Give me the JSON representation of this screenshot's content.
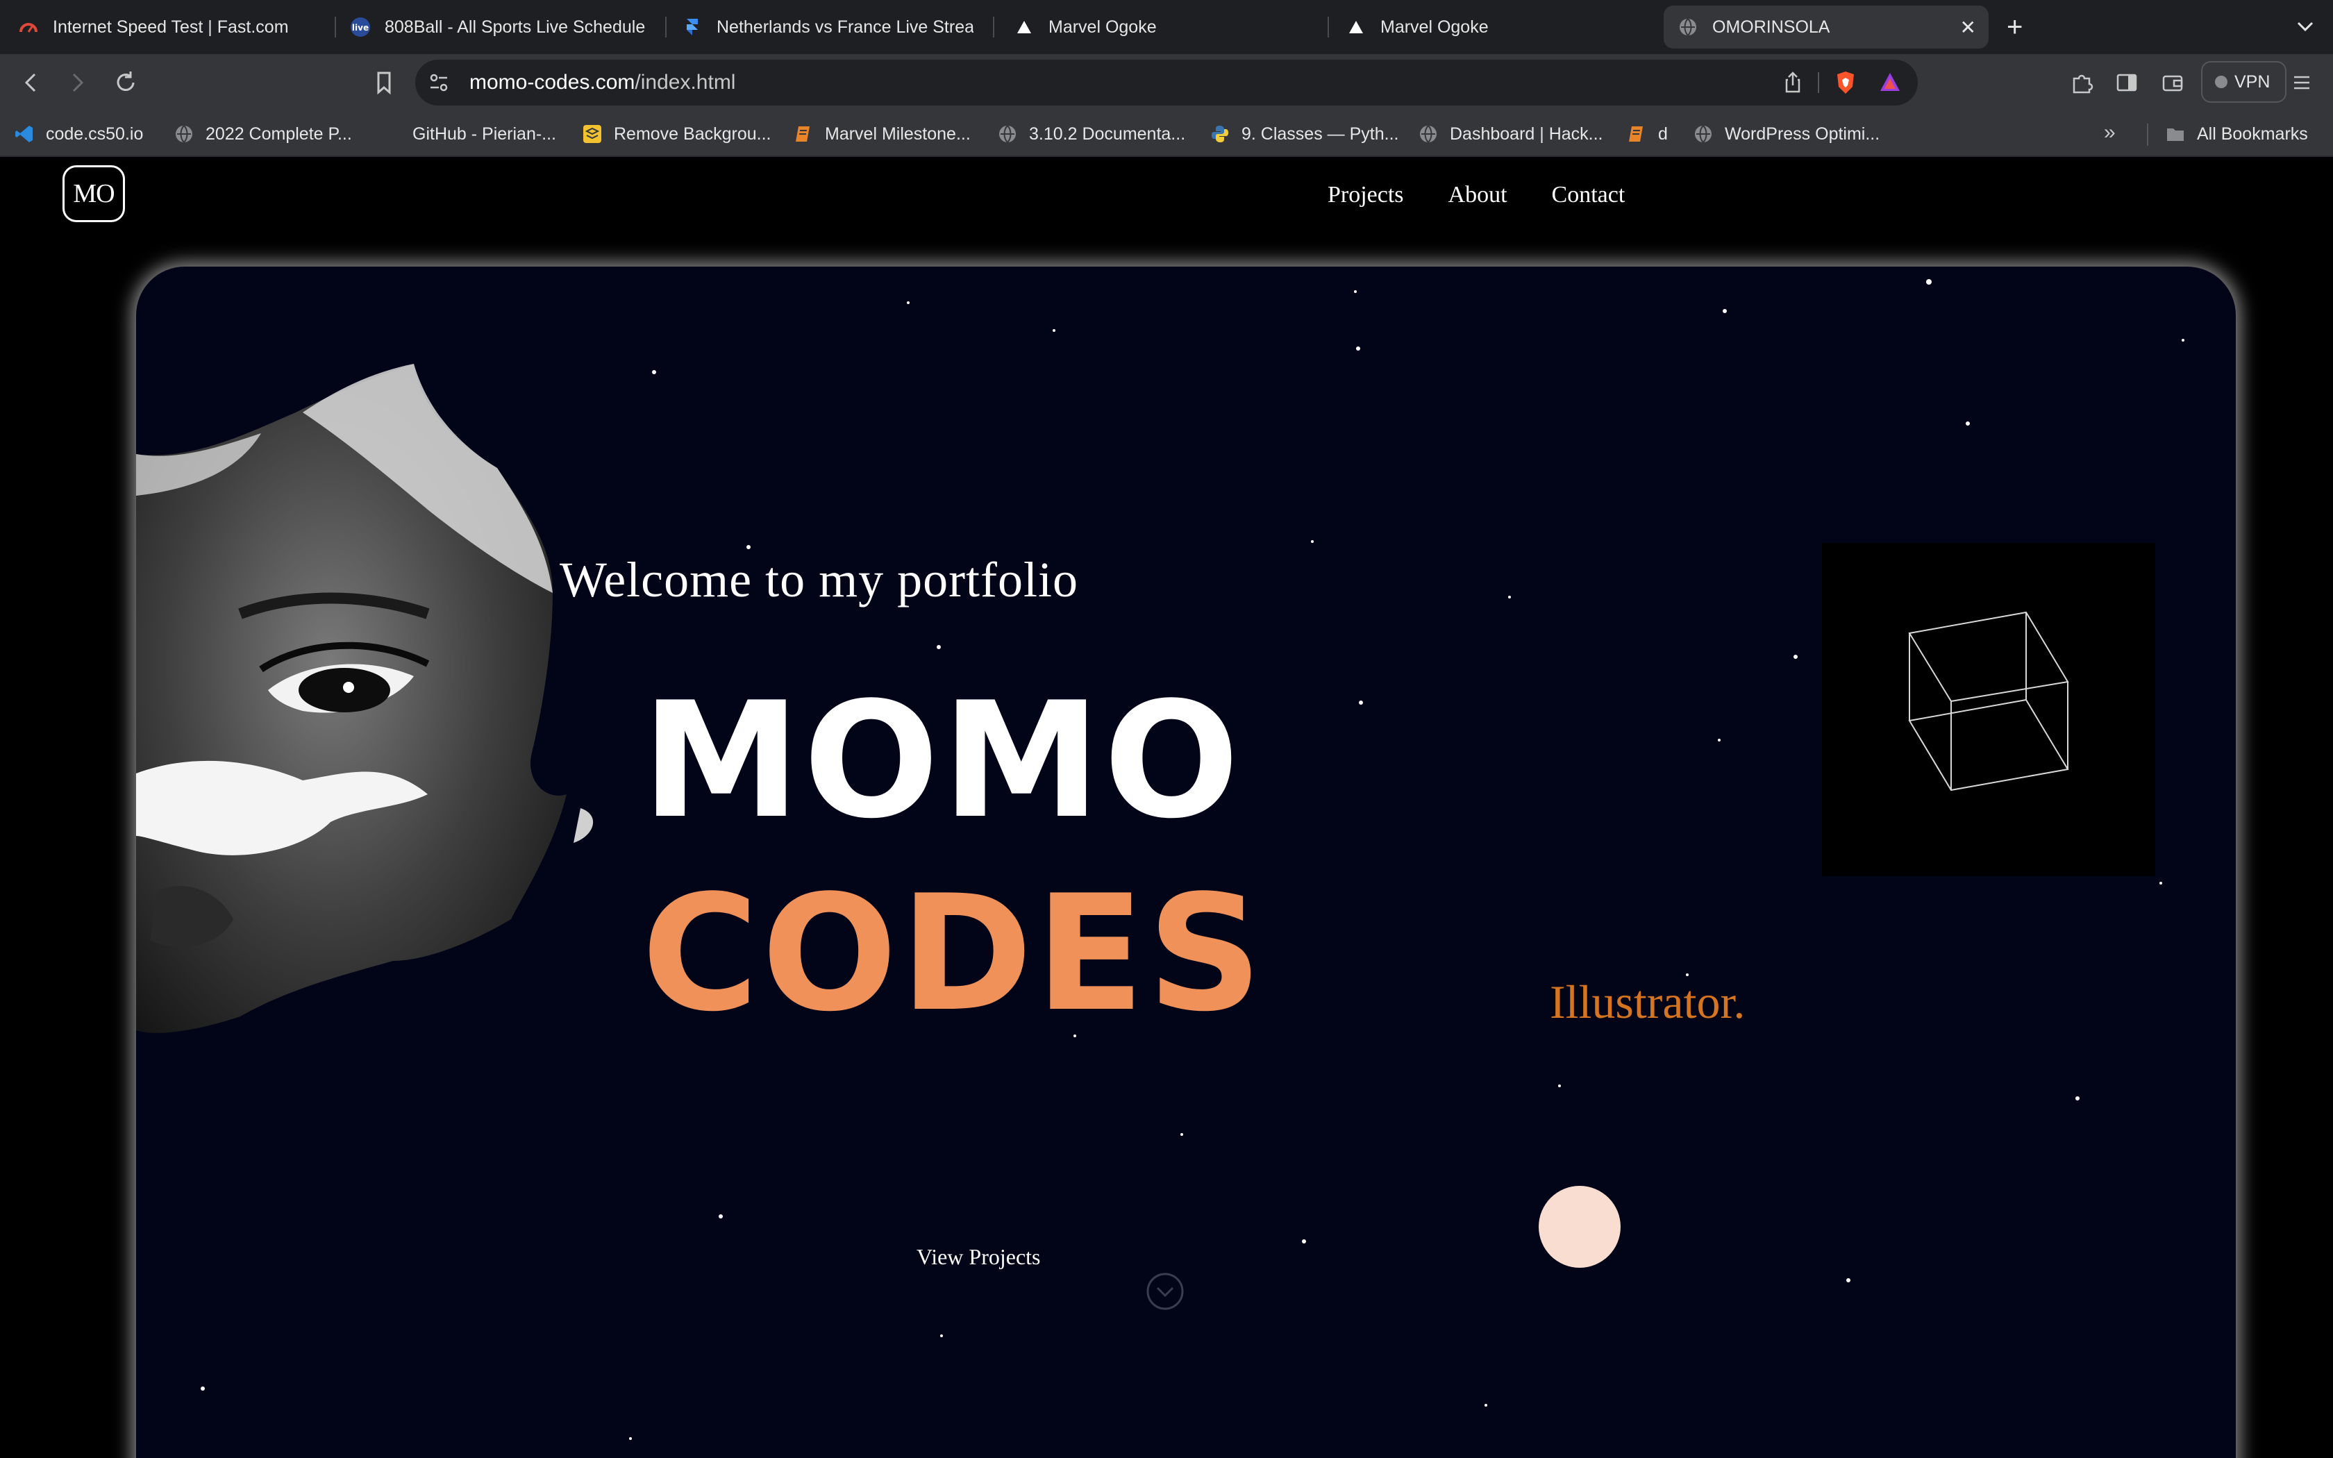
{
  "browser": {
    "tabs": [
      {
        "title": "Internet Speed Test | Fast.com",
        "icon": "speedometer-icon",
        "active": false
      },
      {
        "title": "808Ball - All Sports Live Schedule",
        "icon": "live-badge-icon",
        "active": false
      },
      {
        "title": "Netherlands vs France Live Stream",
        "icon": "framer-icon",
        "active": false
      },
      {
        "title": "Marvel Ogoke",
        "icon": "triangle-icon",
        "active": false
      },
      {
        "title": "Marvel Ogoke",
        "icon": "triangle-icon",
        "active": false
      },
      {
        "title": "OMORINSOLA",
        "icon": "globe-icon",
        "active": true
      }
    ],
    "address": {
      "host": "momo-codes.com",
      "path": "/index.html"
    },
    "vpn_label": "VPN",
    "bookmarks": [
      {
        "label": "code.cs50.io",
        "icon": "vscode-icon"
      },
      {
        "label": "2022 Complete P...",
        "icon": "globe-icon"
      },
      {
        "label": "GitHub - Pierian-...",
        "icon": "github-icon"
      },
      {
        "label": "Remove Backgrou...",
        "icon": "removebg-icon"
      },
      {
        "label": "Marvel Milestone...",
        "icon": "notebook-icon"
      },
      {
        "label": "3.10.2 Documenta...",
        "icon": "globe-icon"
      },
      {
        "label": "9. Classes — Pyth...",
        "icon": "python-icon"
      },
      {
        "label": "Dashboard | Hack...",
        "icon": "globe-icon"
      },
      {
        "label": "d",
        "icon": "notebook-icon"
      },
      {
        "label": "WordPress Optimi...",
        "icon": "globe-icon"
      }
    ],
    "all_bookmarks_label": "All Bookmarks"
  },
  "site": {
    "logo_text": "MO",
    "nav": [
      "Projects",
      "About",
      "Contact"
    ],
    "hero": {
      "welcome": "Welcome to my portfolio",
      "name_line1": "MOMO",
      "name_line2": "CODES",
      "role": "Illustrator.",
      "cta": "View Projects"
    },
    "colors": {
      "background": "#020418",
      "accent_orange": "#f0915a",
      "role_orange": "#d6741f",
      "orb": "#f8ddd0"
    }
  }
}
